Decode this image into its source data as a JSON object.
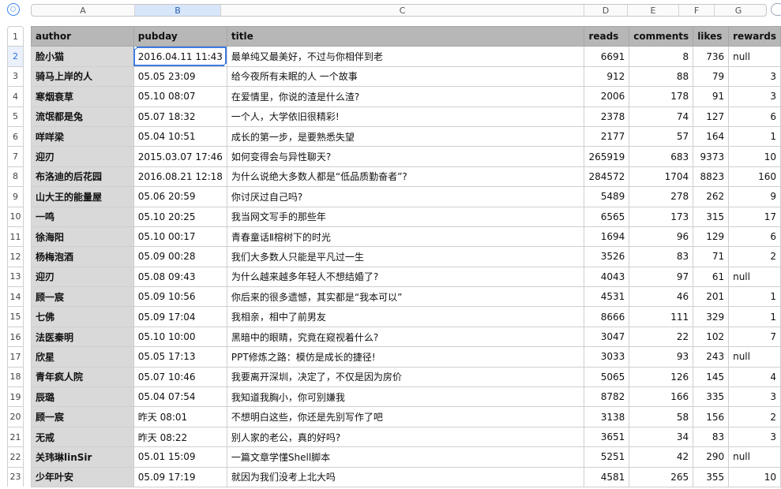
{
  "columns": [
    "A",
    "B",
    "C",
    "D",
    "E",
    "F",
    "G"
  ],
  "selected_column": "B",
  "row_numbers": [
    "1",
    "2",
    "3",
    "4",
    "5",
    "6",
    "7",
    "8",
    "9",
    "10",
    "11",
    "12",
    "13",
    "14",
    "15",
    "16",
    "17",
    "18",
    "19",
    "20",
    "21",
    "22",
    "23"
  ],
  "selected_row": "2",
  "headers": [
    "author",
    "pubday",
    "title",
    "reads",
    "comments",
    "likes",
    "rewards"
  ],
  "rows": [
    [
      "脸小猫",
      "2016.04.11 11:43",
      "最单纯又最美好，不过与你相伴到老",
      "6691",
      "8",
      "736",
      "null"
    ],
    [
      "骑马上岸的人",
      "05.05 23:09",
      "给今夜所有未眠的人 一个故事",
      "912",
      "88",
      "79",
      "3"
    ],
    [
      "寒烟衰草",
      "05.10 08:07",
      "在爱情里，你说的渣是什么渣?",
      "2006",
      "178",
      "91",
      "3"
    ],
    [
      "流氓都是兔",
      "05.07 18:32",
      "一个人，大学依旧很精彩!",
      "2378",
      "74",
      "127",
      "6"
    ],
    [
      "咩咩梁",
      "05.04 10:51",
      "成长的第一步，是要熟悉失望",
      "2177",
      "57",
      "164",
      "1"
    ],
    [
      "迎刃",
      "2015.03.07 17:46",
      "如何变得会与异性聊天?",
      "265919",
      "683",
      "9373",
      "10"
    ],
    [
      "布洛迪的后花园",
      "2016.08.21 12:18",
      "为什么说绝大多数人都是“低品质勤奋者”?",
      "284572",
      "1704",
      "8823",
      "160"
    ],
    [
      "山大王的能量屋",
      "05.06 20:59",
      "你讨厌过自己吗?",
      "5489",
      "278",
      "262",
      "9"
    ],
    [
      "一鸣",
      "05.10 20:25",
      "我当网文写手的那些年",
      "6565",
      "173",
      "315",
      "17"
    ],
    [
      "徐海阳",
      "05.10 00:17",
      "青春童话Ⅱ榕树下的时光",
      "1694",
      "96",
      "129",
      "6"
    ],
    [
      "杨梅泡酒",
      "05.09 00:28",
      "我们大多数人只能是平凡过一生",
      "3526",
      "83",
      "71",
      "2"
    ],
    [
      "迎刃",
      "05.08 09:43",
      "为什么越来越多年轻人不想结婚了?",
      "4043",
      "97",
      "61",
      "null"
    ],
    [
      "顾一宸",
      "05.09 10:56",
      "你后来的很多遗憾，其实都是“我本可以”",
      "4531",
      "46",
      "201",
      "1"
    ],
    [
      "七佛",
      "05.09 17:04",
      "我相亲，相中了前男友",
      "8666",
      "111",
      "329",
      "1"
    ],
    [
      "法医秦明",
      "05.10 10:00",
      "黑暗中的眼睛，究竟在窥视着什么?",
      "3047",
      "22",
      "102",
      "7"
    ],
    [
      "欣星",
      "05.05 17:13",
      "PPT修炼之路：模仿是成长的捷径!",
      "3033",
      "93",
      "243",
      "null"
    ],
    [
      "青年疯人院",
      "05.07 10:46",
      "我要离开深圳，决定了，不仅是因为房价",
      "5065",
      "126",
      "145",
      "4"
    ],
    [
      "辰璐",
      "05.04 07:54",
      "我知道我胸小，你可别嫌我",
      "8782",
      "166",
      "335",
      "3"
    ],
    [
      "顾一宸",
      "昨天 08:01",
      "不想明白这些，你还是先别写作了吧",
      "3138",
      "58",
      "156",
      "2"
    ],
    [
      "无戒",
      "昨天 08:22",
      "别人家的老公，真的好吗?",
      "3651",
      "34",
      "83",
      "3"
    ],
    [
      "关玮琳linSir",
      "05.01 15:09",
      "一篇文章学懂Shell脚本",
      "5251",
      "42",
      "290",
      "null"
    ],
    [
      "少年叶安",
      "05.09 17:19",
      "就因为我们没考上北大吗",
      "4581",
      "265",
      "355",
      "10"
    ]
  ]
}
